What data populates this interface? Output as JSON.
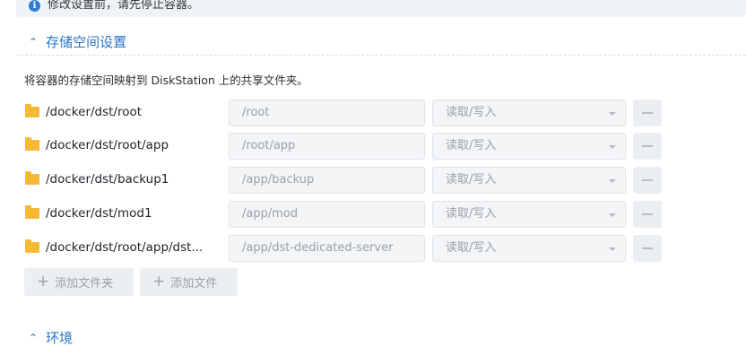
{
  "notice": {
    "icon": "info-icon",
    "text": "修改设置前，请先停止容器。"
  },
  "storage_section": {
    "title": "存储空间设置",
    "icon": "chevron-up-icon",
    "description": "将容器的存储空间映射到 DiskStation 上的共享文件夹。",
    "rows": [
      {
        "path": "/docker/dst/root",
        "mount": "/root",
        "permission": "读取/写入"
      },
      {
        "path": "/docker/dst/root/app",
        "mount": "/root/app",
        "permission": "读取/写入"
      },
      {
        "path": "/docker/dst/backup1",
        "mount": "/app/backup",
        "permission": "读取/写入"
      },
      {
        "path": "/docker/dst/mod1",
        "mount": "/app/mod",
        "permission": "读取/写入"
      },
      {
        "path": "/docker/dst/root/app/dst...",
        "mount": "/app/dst-dedicated-server",
        "permission": "读取/写入"
      }
    ],
    "add_folder_label": "添加文件夹",
    "add_file_label": "添加文件"
  },
  "env_section": {
    "title": "环境",
    "icon": "chevron-up-icon"
  }
}
